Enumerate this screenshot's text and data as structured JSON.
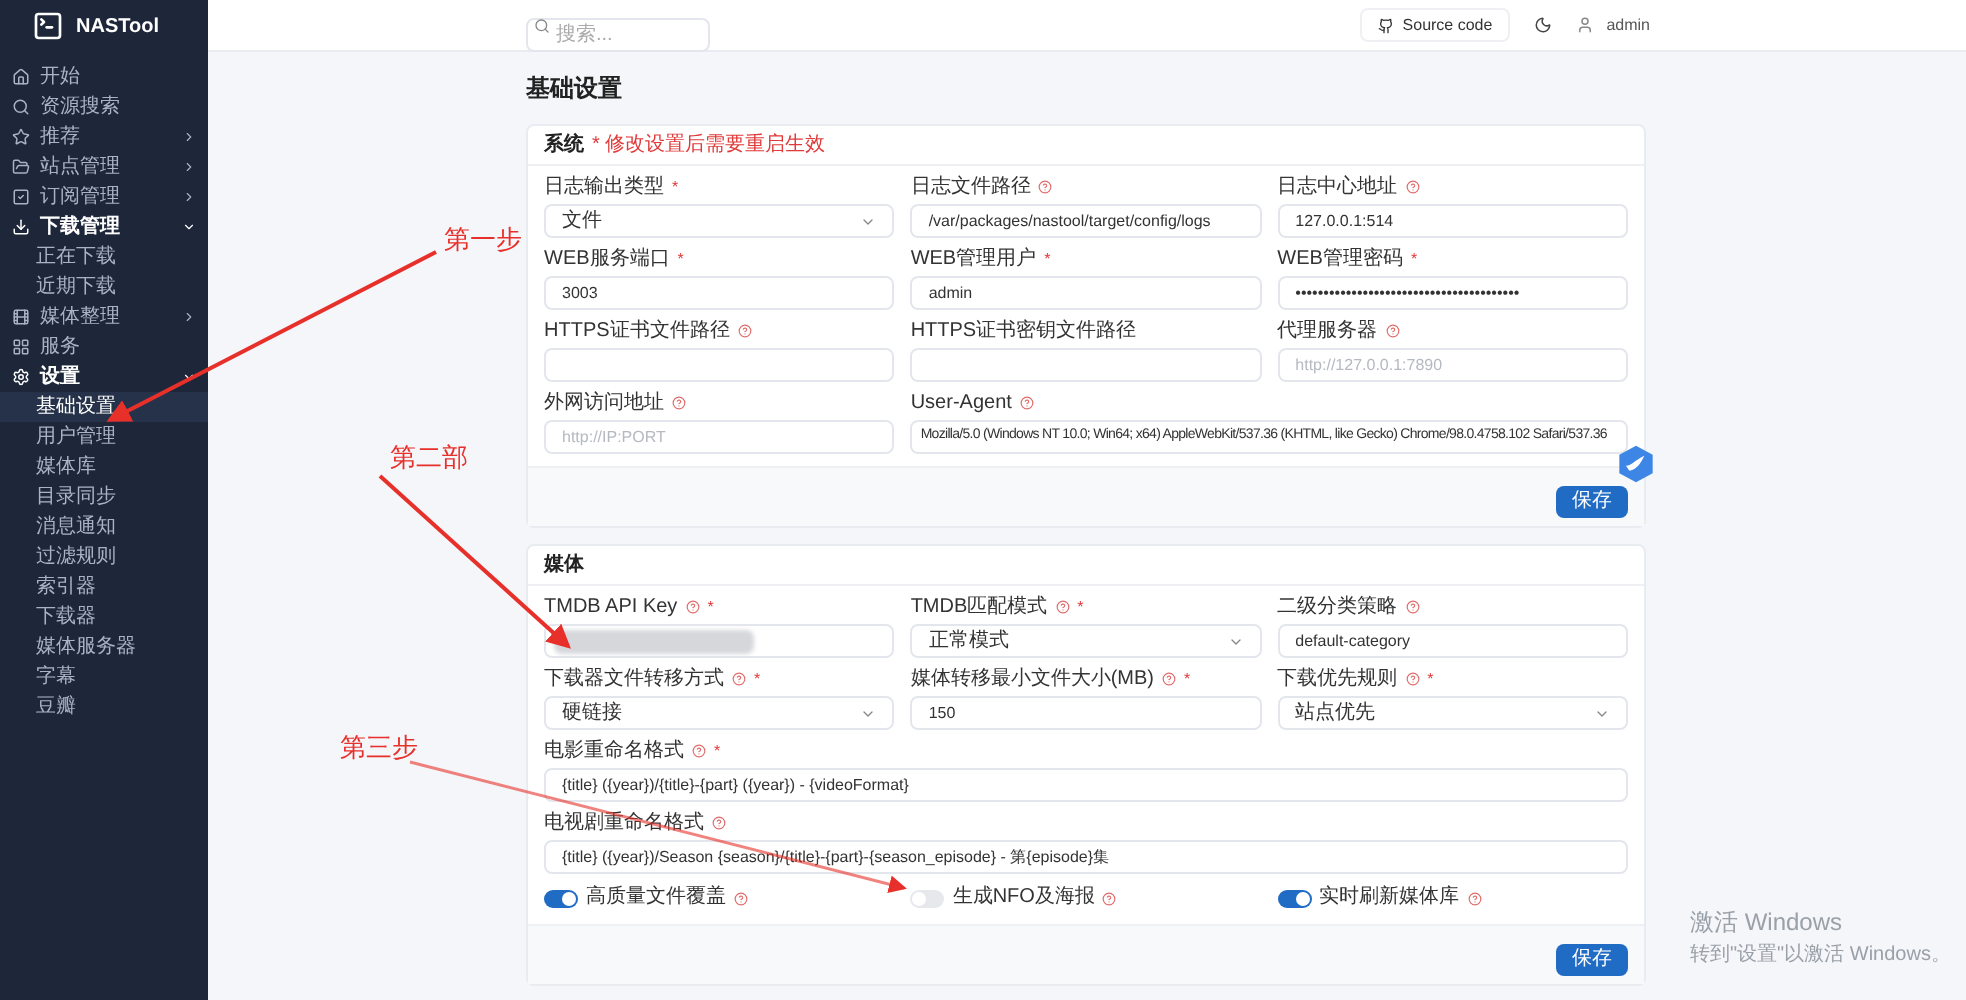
{
  "sidebar": {
    "app_name": "NASTool",
    "items": [
      {
        "label": "开始",
        "expandable": false,
        "expanded": false,
        "selected": false
      },
      {
        "label": "资源搜索",
        "expandable": false,
        "expanded": false,
        "selected": false
      },
      {
        "label": "推荐",
        "expandable": true,
        "expanded": false,
        "selected": false
      },
      {
        "label": "站点管理",
        "expandable": true,
        "expanded": false,
        "selected": false
      },
      {
        "label": "订阅管理",
        "expandable": true,
        "expanded": false,
        "selected": false
      },
      {
        "label": "下载管理",
        "expandable": true,
        "expanded": true,
        "selected": false,
        "children": [
          {
            "label": "正在下载",
            "selected": false
          },
          {
            "label": "近期下载",
            "selected": false
          }
        ]
      },
      {
        "label": "媒体整理",
        "expandable": true,
        "expanded": false,
        "selected": false
      },
      {
        "label": "服务",
        "expandable": false,
        "expanded": false,
        "selected": false
      },
      {
        "label": "设置",
        "expandable": true,
        "expanded": true,
        "selected": false,
        "children": [
          {
            "label": "基础设置",
            "selected": true
          },
          {
            "label": "用户管理",
            "selected": false
          },
          {
            "label": "媒体库",
            "selected": false
          },
          {
            "label": "目录同步",
            "selected": false
          },
          {
            "label": "消息通知",
            "selected": false
          },
          {
            "label": "过滤规则",
            "selected": false
          },
          {
            "label": "索引器",
            "selected": false
          },
          {
            "label": "下载器",
            "selected": false
          },
          {
            "label": "媒体服务器",
            "selected": false
          },
          {
            "label": "字幕",
            "selected": false
          },
          {
            "label": "豆瓣",
            "selected": false
          }
        ]
      }
    ]
  },
  "header": {
    "search": {
      "placeholder": "搜索..."
    },
    "source_code": "Source code",
    "user": "admin"
  },
  "page_title": "基础设置",
  "sections": [
    {
      "title": "系统",
      "note": "* 修改设置后需要重启生效",
      "save": "保存",
      "fields": [
        {
          "kind": "select",
          "label": "日志输出类型",
          "help": false,
          "required": "*",
          "value": "文件"
        },
        {
          "kind": "input",
          "label": "日志文件路径",
          "help": true,
          "value": "/var/packages/nastool/target/config/logs"
        },
        {
          "kind": "input",
          "label": "日志中心地址",
          "help": true,
          "value": "127.0.0.1:514"
        },
        {
          "kind": "input",
          "label": "WEB服务端口",
          "help": false,
          "required": "*",
          "value": "3003"
        },
        {
          "kind": "input",
          "label": "WEB管理用户",
          "help": false,
          "required": "*",
          "value": "admin"
        },
        {
          "kind": "input",
          "label": "WEB管理密码",
          "help": false,
          "required": "*",
          "value": "••••••••••••••••••••••••••••••••••••••••"
        },
        {
          "kind": "input",
          "label": "HTTPS证书文件路径",
          "help": true
        },
        {
          "kind": "input",
          "label": "HTTPS证书密钥文件路径",
          "help": false
        },
        {
          "kind": "input",
          "label": "代理服务器",
          "help": true,
          "placeholder": "http://127.0.0.1:7890"
        },
        {
          "kind": "input",
          "label": "外网访问地址",
          "help": true,
          "placeholder": "http://IP:PORT"
        },
        {
          "kind": "wide_input",
          "label": "User-Agent",
          "help": true,
          "value": "Mozilla/5.0 (Windows NT 10.0; Win64; x64) AppleWebKit/537.36 (KHTML, like Gecko) Chrome/98.0.4758.102 Safari/537.36"
        }
      ]
    },
    {
      "title": "媒体",
      "save": "保存",
      "fields": [
        {
          "kind": "blurred",
          "label": "TMDB API Key",
          "help": true,
          "required": "*"
        },
        {
          "kind": "select",
          "label": "TMDB匹配模式",
          "help": true,
          "required": "*",
          "value": "正常模式"
        },
        {
          "kind": "input",
          "label": "二级分类策略",
          "help": true,
          "value": "default-category"
        },
        {
          "kind": "select",
          "label": "下载器文件转移方式",
          "help": true,
          "required": "*",
          "value": "硬链接"
        },
        {
          "kind": "input",
          "label": "媒体转移最小文件大小(MB)",
          "help": true,
          "required": "*",
          "value": "150"
        },
        {
          "kind": "select",
          "label": "下载优先规则",
          "help": true,
          "required": "*",
          "value": "站点优先"
        },
        {
          "kind": "full_input",
          "label": "电影重命名格式",
          "help": true,
          "required": "*",
          "value": "{title} ({year})/{title}-{part} ({year}) - {videoFormat}"
        },
        {
          "kind": "full_input",
          "label": "电视剧重命名格式",
          "help": true,
          "value": "{title} ({year})/Season {season}/{title}-{part}-{season_episode} - 第{episode}集"
        }
      ],
      "switches": [
        {
          "label": "高质量文件覆盖",
          "on": true
        },
        {
          "label": "生成NFO及海报",
          "on": false
        },
        {
          "label": "实时刷新媒体库",
          "on": true
        }
      ]
    }
  ],
  "annotations": [
    {
      "text": "第一步"
    },
    {
      "text": "第二部"
    },
    {
      "text": "第三步"
    }
  ],
  "os_notice": {
    "title": "激活 Windows",
    "subtitle": "转到\"设置\"以激活 Windows。"
  }
}
